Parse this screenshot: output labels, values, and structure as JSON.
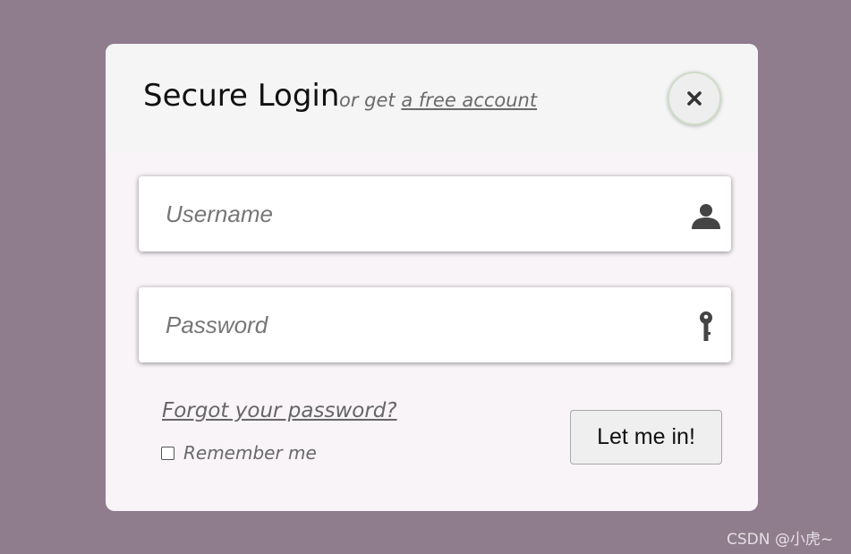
{
  "header": {
    "title": "Secure Login",
    "subtitle_prefix": "or get",
    "subtitle_link": "a free account"
  },
  "form": {
    "username": {
      "value": "",
      "placeholder": "Username",
      "icon": "user-icon"
    },
    "password": {
      "value": "",
      "placeholder": "Password",
      "icon": "key-icon"
    },
    "forgot_link": "Forgot your password?",
    "remember_label": "Remember me",
    "remember_checked": false,
    "submit_label": "Let me in!"
  },
  "close_icon": "close-icon",
  "watermark": "CSDN @小虎~",
  "colors": {
    "page_background": "#8f7c8c",
    "modal_background": "#f8f4f8",
    "header_background": "#f5f5f5",
    "link_text": "#6a6a6a"
  }
}
